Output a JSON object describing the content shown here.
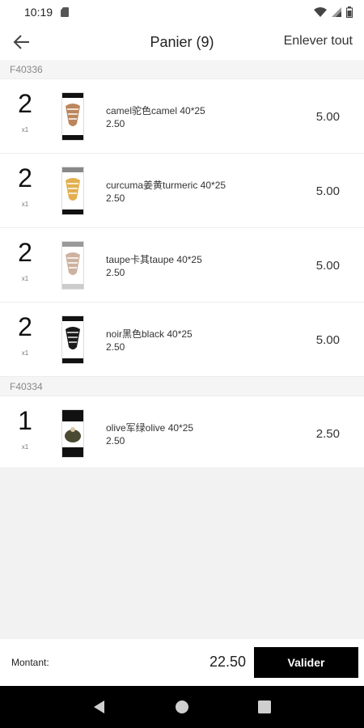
{
  "status": {
    "time": "10:19"
  },
  "header": {
    "title": "Panier (9)",
    "clear_label": "Enlever tout",
    "back_icon": "arrow-left-icon"
  },
  "groups": [
    {
      "code": "F40336",
      "items": [
        {
          "qty": "2",
          "unit": "x1",
          "name": "camel驼色camel 40*25",
          "price": "2.50",
          "total": "5.00",
          "swatch": "#b0713f"
        },
        {
          "qty": "2",
          "unit": "x1",
          "name": "curcuma姜黄turmeric 40*25",
          "price": "2.50",
          "total": "5.00",
          "swatch": "#e0a63b"
        },
        {
          "qty": "2",
          "unit": "x1",
          "name": "taupe卡其taupe 40*25",
          "price": "2.50",
          "total": "5.00",
          "swatch": "#c9a896"
        },
        {
          "qty": "2",
          "unit": "x1",
          "name": "noir黑色black 40*25",
          "price": "2.50",
          "total": "5.00",
          "swatch": "#1a1a1a"
        }
      ]
    },
    {
      "code": "F40334",
      "items": [
        {
          "qty": "1",
          "unit": "x1",
          "name": "olive军绿olive 40*25",
          "price": "2.50",
          "total": "2.50",
          "swatch": "#4a4a32"
        }
      ]
    }
  ],
  "footer": {
    "amount_label": "Montant:",
    "amount_value": "22.50",
    "validate_label": "Valider"
  },
  "nav": {
    "back_icon": "nav-back-triangle-icon",
    "home_icon": "nav-home-circle-icon",
    "recents_icon": "nav-recents-square-icon"
  }
}
